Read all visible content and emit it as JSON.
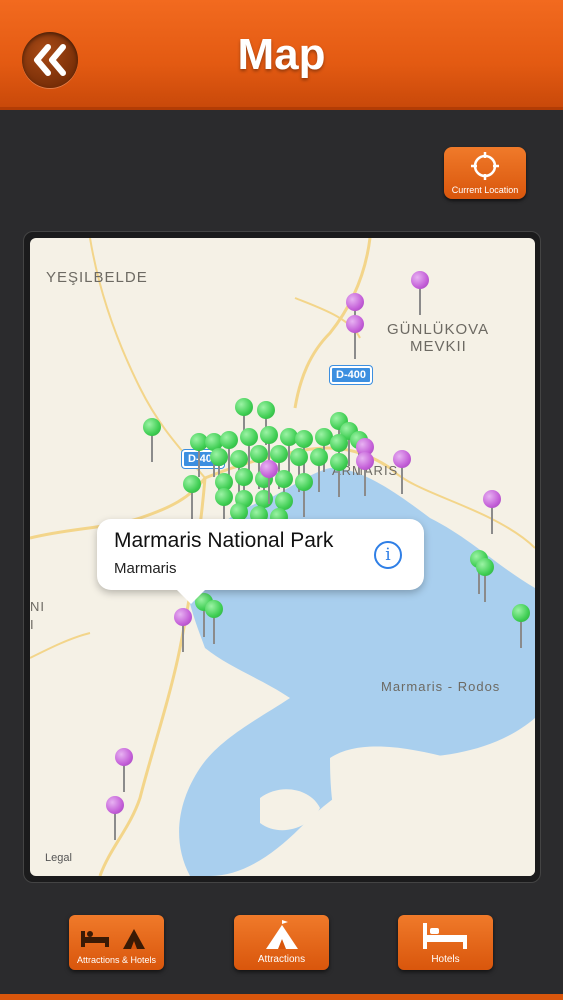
{
  "header": {
    "title": "Map",
    "back_icon": "double-chevron-left-icon"
  },
  "current_location": {
    "label": "Current Location",
    "icon": "crosshair-icon"
  },
  "map": {
    "labels": [
      "YEŞILBELDE",
      "GÜNLÜKOVA",
      "MEVKII",
      "ARMARIS",
      "Marmaris - Rodos",
      "NI",
      "I"
    ],
    "road_shields": [
      "D-400",
      "D-400"
    ],
    "legal": "Legal",
    "pin_colors": {
      "attraction": "#3fce53",
      "hotel": "#c45fd8"
    },
    "callout": {
      "title": "Marmaris National Park",
      "subtitle": "Marmaris",
      "info_icon": "info-icon"
    }
  },
  "bottom_bar": {
    "buttons": [
      {
        "label": "Attractions & Hotels",
        "icon": "tent-and-bed-icon"
      },
      {
        "label": "Attractions",
        "icon": "tent-icon"
      },
      {
        "label": "Hotels",
        "icon": "bed-icon"
      }
    ]
  },
  "colors": {
    "accent": "#e35a12",
    "background": "#2b2b2d"
  }
}
